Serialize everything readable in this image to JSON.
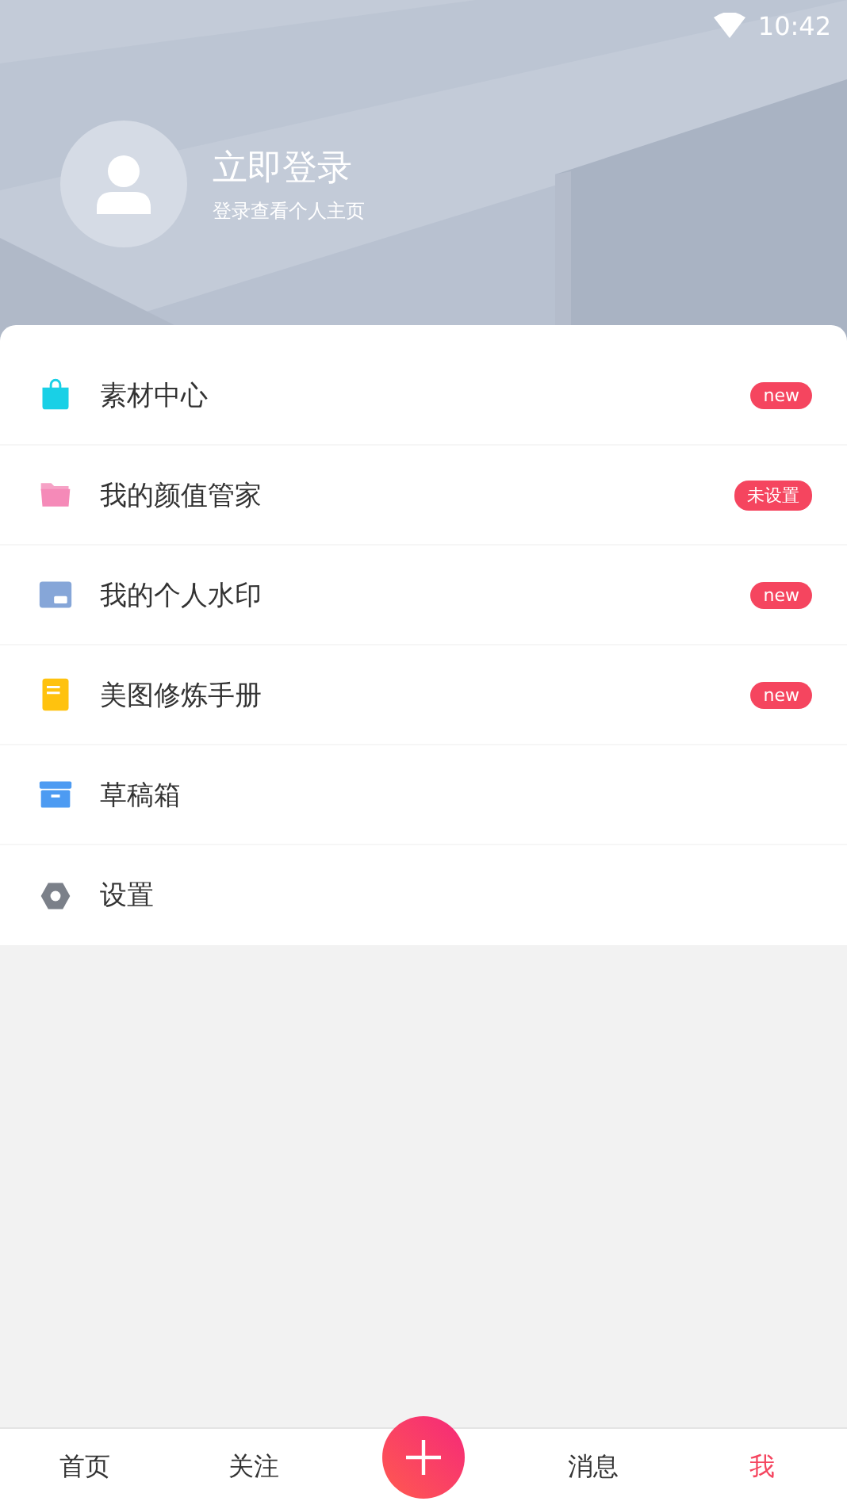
{
  "status_bar": {
    "time": "10:42"
  },
  "profile": {
    "title": "立即登录",
    "subtitle": "登录查看个人主页"
  },
  "menu": [
    {
      "label": "素材中心",
      "badge": "new"
    },
    {
      "label": "我的颜值管家",
      "badge": "未设置"
    },
    {
      "label": "我的个人水印",
      "badge": "new"
    },
    {
      "label": "美图修炼手册",
      "badge": "new"
    },
    {
      "label": "草稿箱"
    },
    {
      "label": "设置"
    }
  ],
  "tabs": [
    {
      "label": "首页",
      "selected": false
    },
    {
      "label": "关注",
      "selected": false
    },
    {
      "kind": "add"
    },
    {
      "label": "消息",
      "selected": false
    },
    {
      "label": "我",
      "selected": true
    }
  ]
}
